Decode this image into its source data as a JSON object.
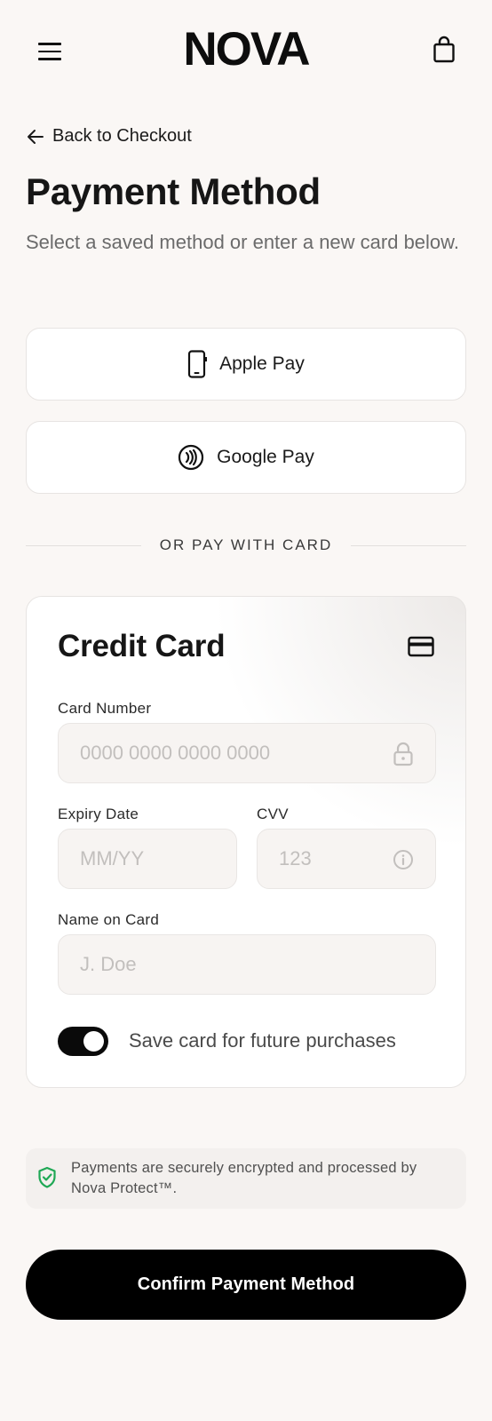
{
  "header": {
    "logo": "NOVA",
    "menu_icon": "hamburger-menu-icon",
    "bag_icon": "shopping-bag-icon"
  },
  "nav": {
    "back_label": "Back to Checkout",
    "back_icon": "arrow-left-icon"
  },
  "page": {
    "title": "Payment Method",
    "subtitle": "Select a saved method or enter a new card below."
  },
  "wallets": {
    "apple_pay": {
      "label": "Apple Pay",
      "icon": "phone-icon"
    },
    "google_pay": {
      "label": "Google Pay",
      "icon": "contactless-icon"
    }
  },
  "divider": {
    "text": "OR PAY WITH CARD"
  },
  "card_form": {
    "title": "Credit Card",
    "icon": "credit-card-icon",
    "card_number": {
      "label": "Card Number",
      "placeholder": "0000 0000 0000 0000",
      "value": "",
      "icon": "lock-icon"
    },
    "expiry": {
      "label": "Expiry Date",
      "placeholder": "MM/YY",
      "value": ""
    },
    "cvv": {
      "label": "CVV",
      "placeholder": "123",
      "value": "",
      "icon": "info-icon"
    },
    "name": {
      "label": "Name on Card",
      "placeholder": "J. Doe",
      "value": ""
    },
    "save_card": {
      "label": "Save card for future purchases",
      "checked": true
    }
  },
  "security": {
    "icon": "shield-check-icon",
    "text": "Payments are securely encrypted and processed by Nova Protect™."
  },
  "confirm": {
    "label": "Confirm Payment Method"
  },
  "colors": {
    "accent": "#000000",
    "background": "#faf7f5",
    "secure_icon": "#1fa855"
  }
}
